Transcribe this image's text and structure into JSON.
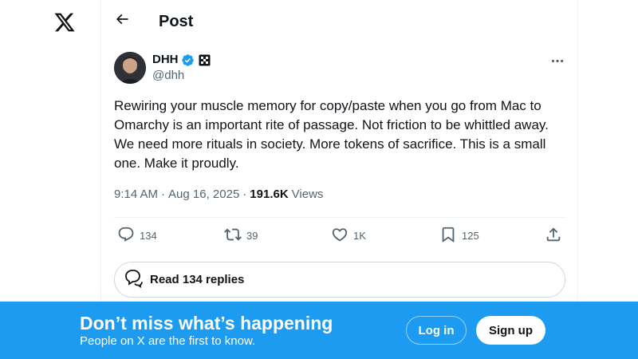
{
  "app": {
    "logo_icon": "x-logo-icon"
  },
  "header": {
    "title": "Post",
    "back_icon": "arrow-left-icon"
  },
  "post": {
    "author": {
      "name": "DHH",
      "handle": "@dhh",
      "verified_icon": "verified-badge-icon",
      "verified_color": "#1d9bf0",
      "affiliate_icon": "affiliate-badge-icon"
    },
    "more_icon": "more-dots-icon",
    "text": "Rewiring your muscle memory for copy/paste when you go from Mac to Omarchy is an important rite of passage. Not friction to be whittled away. We need more rituals in society. More tokens of sacrifice. This is a small one. Make it proudly.",
    "time": "9:14 AM",
    "date": "Aug 16, 2025",
    "separator": "·",
    "views_count": "191.6K",
    "views_label": "Views",
    "actions": {
      "replies": {
        "icon": "reply-icon",
        "count": "134"
      },
      "reposts": {
        "icon": "repost-icon",
        "count": "39"
      },
      "likes": {
        "icon": "heart-icon",
        "count": "1K"
      },
      "bookmarks": {
        "icon": "bookmark-icon",
        "count": "125"
      },
      "share": {
        "icon": "share-icon"
      }
    },
    "read_replies_label": "Read 134 replies"
  },
  "banner": {
    "title": "Don’t miss what’s happening",
    "subtitle": "People on X are the first to know.",
    "login_label": "Log in",
    "signup_label": "Sign up",
    "color": "#1d9bf0"
  }
}
